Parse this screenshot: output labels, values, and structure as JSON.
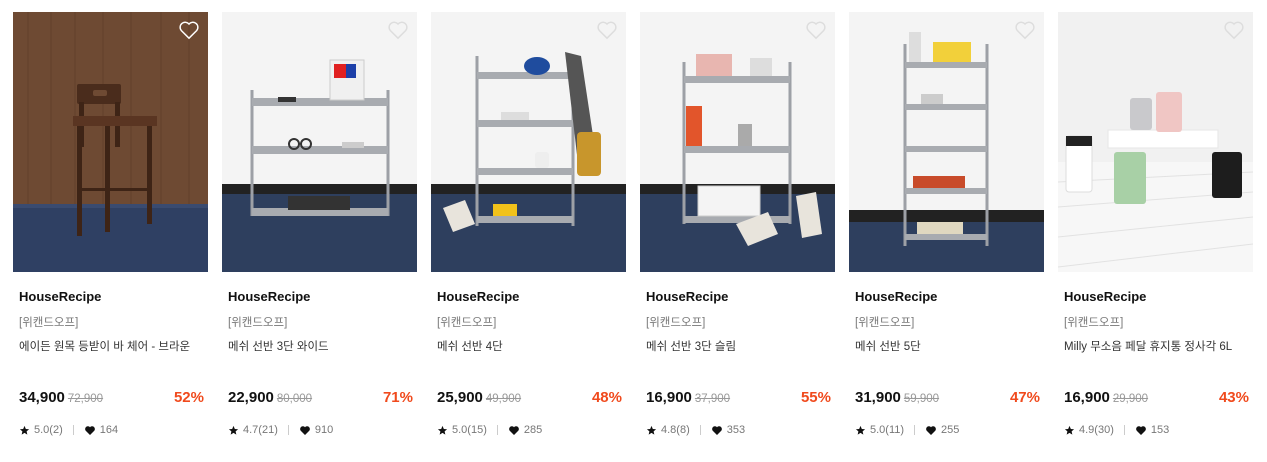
{
  "products": [
    {
      "brand": "HouseRecipe",
      "tag": "[위캔드오프]",
      "name": "에이든 원목 등받이 바 체어 - 브라운",
      "price": "34,900",
      "original_price": "72,900",
      "discount": "52%",
      "rating": "5.0(2)",
      "likes": "164",
      "image": "wooden-bar-chair"
    },
    {
      "brand": "HouseRecipe",
      "tag": "[위캔드오프]",
      "name": "메쉬 선반 3단 와이드",
      "price": "22,900",
      "original_price": "80,000",
      "discount": "71%",
      "rating": "4.7(21)",
      "likes": "910",
      "image": "mesh-shelf-3-wide"
    },
    {
      "brand": "HouseRecipe",
      "tag": "[위캔드오프]",
      "name": "메쉬 선반 4단",
      "price": "25,900",
      "original_price": "49,900",
      "discount": "48%",
      "rating": "5.0(15)",
      "likes": "285",
      "image": "mesh-shelf-4"
    },
    {
      "brand": "HouseRecipe",
      "tag": "[위캔드오프]",
      "name": "메쉬 선반 3단 슬림",
      "price": "16,900",
      "original_price": "37,900",
      "discount": "55%",
      "rating": "4.8(8)",
      "likes": "353",
      "image": "mesh-shelf-3-slim"
    },
    {
      "brand": "HouseRecipe",
      "tag": "[위캔드오프]",
      "name": "메쉬 선반 5단",
      "price": "31,900",
      "original_price": "59,900",
      "discount": "47%",
      "rating": "5.0(11)",
      "likes": "255",
      "image": "mesh-shelf-5"
    },
    {
      "brand": "HouseRecipe",
      "tag": "[위캔드오프]",
      "name": "Milly 무소음 페달 휴지통 정사각 6L",
      "price": "16,900",
      "original_price": "29,900",
      "discount": "43%",
      "rating": "4.9(30)",
      "likes": "153",
      "image": "pedal-trash-bins"
    }
  ],
  "colors": {
    "discount": "#f04a1d",
    "floor": "#2e3f5e",
    "wall": "#f3f3f3",
    "shelf": "#9da0a6"
  },
  "icons": {
    "wishlist": "heart-outline-icon",
    "rating": "star-icon",
    "likes": "heart-filled-icon"
  }
}
